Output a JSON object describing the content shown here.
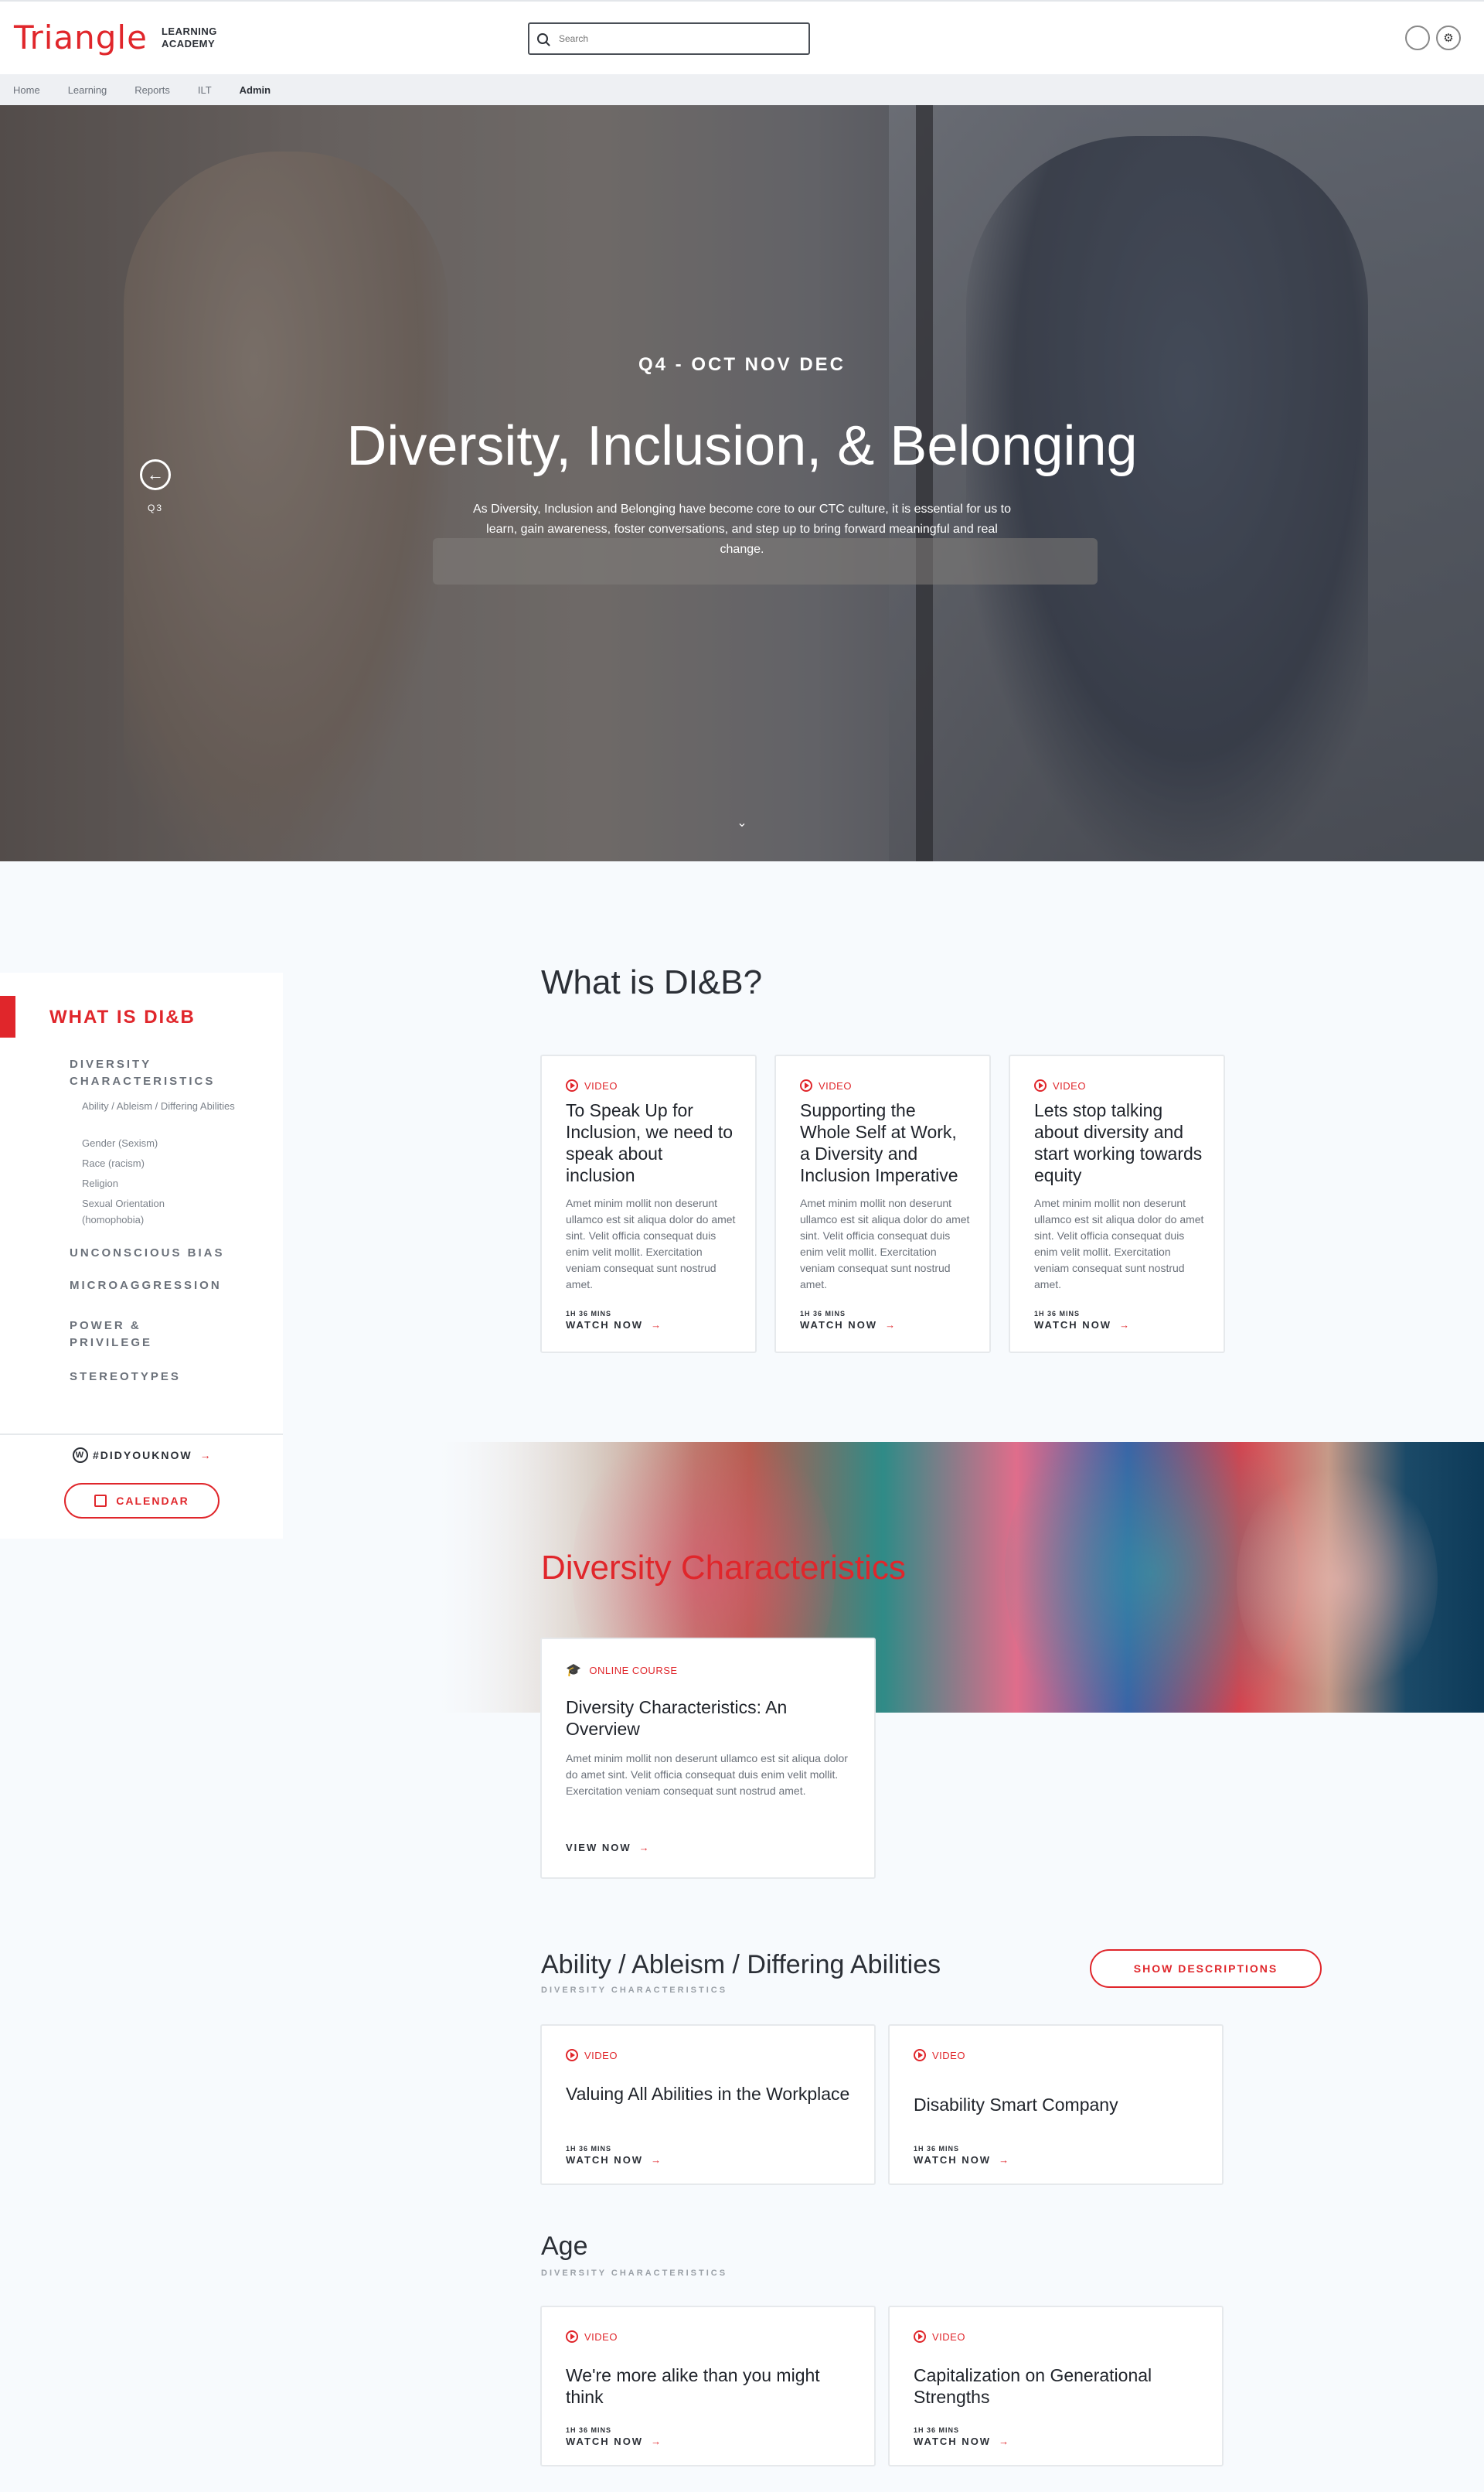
{
  "header": {
    "logo_text": "Triangle",
    "logo_sub_line1": "LEARNING",
    "logo_sub_line2": "ACADEMY",
    "search_placeholder": "Search"
  },
  "nav": {
    "items": [
      "Home",
      "Learning",
      "Reports",
      "ILT",
      "Admin"
    ],
    "active": "Admin"
  },
  "hero": {
    "eyebrow": "Q4 - OCT NOV DEC",
    "title": "Diversity, Inclusion, & Belonging",
    "description": "As Diversity, Inclusion and Belonging have become core to our CTC culture, it is essential for us to learn, gain awareness, foster conversations, and step up to bring forward meaningful and real change.",
    "prev_label": "Q3"
  },
  "sidebar": {
    "title": "WHAT IS DI&B",
    "links": [
      {
        "label": "DIVERSITY CHARACTERISTICS",
        "subs": [
          "Ability / Ableism / Differing Abilities",
          "Gender (Sexism)",
          "Race (racism)",
          "Religion",
          "Sexual Orientation (homophobia)"
        ]
      },
      {
        "label": "UNCONSCIOUS BIAS"
      },
      {
        "label": "MICROAGGRESSION"
      },
      {
        "label": "POWER & PRIVILEGE"
      },
      {
        "label": "STEREOTYPES"
      }
    ],
    "didyouknow": "#DIDYOUKNOW",
    "calendar": "CALENDAR"
  },
  "whatis": {
    "title": "What is DI&B?",
    "cards": [
      {
        "kind": "VIDEO",
        "title": "To Speak Up for Inclusion, we need to speak about inclusion",
        "desc": "Amet minim mollit non deserunt ullamco est sit aliqua dolor do amet sint. Velit officia consequat duis enim velit mollit. Exercitation veniam consequat sunt nostrud amet.",
        "duration": "1H 36 MINS",
        "action": "WATCH NOW"
      },
      {
        "kind": "VIDEO",
        "title": "Supporting the Whole Self at Work, a Diversity and Inclusion Imperative",
        "desc": "Amet minim mollit non deserunt ullamco est sit aliqua dolor do amet sint. Velit officia consequat duis enim velit mollit. Exercitation veniam consequat sunt nostrud amet.",
        "duration": "1H 36 MINS",
        "action": "WATCH NOW"
      },
      {
        "kind": "VIDEO",
        "title": "Lets stop talking about diversity and start working towards equity",
        "desc": "Amet minim mollit non deserunt ullamco est sit aliqua dolor do amet sint. Velit officia consequat duis enim velit mollit. Exercitation veniam consequat sunt nostrud amet.",
        "duration": "1H 36 MINS",
        "action": "WATCH NOW"
      }
    ]
  },
  "diversity": {
    "title": "Diversity Characteristics",
    "course": {
      "kind": "ONLINE COURSE",
      "title": "Diversity Characteristics: An Overview",
      "desc": "Amet minim mollit non deserunt ullamco est sit aliqua dolor do amet sint. Velit officia consequat duis enim velit mollit. Exercitation veniam consequat sunt nostrud amet.",
      "action": "VIEW NOW"
    }
  },
  "ability": {
    "title": "Ability / Ableism / Differing Abilities",
    "eyebrow": "DIVERSITY CHARACTERISTICS",
    "show_button": "SHOW DESCRIPTIONS",
    "cards": [
      {
        "kind": "VIDEO",
        "title": "Valuing All Abilities in the Workplace",
        "duration": "1H 36 MINS",
        "action": "WATCH NOW"
      },
      {
        "kind": "VIDEO",
        "title": "Disability Smart Company",
        "duration": "1H 36 MINS",
        "action": "WATCH NOW"
      }
    ]
  },
  "age": {
    "title": "Age",
    "eyebrow": "DIVERSITY CHARACTERISTICS",
    "cards": [
      {
        "kind": "VIDEO",
        "title": "We're more alike than you might think",
        "duration": "1H 36 MINS",
        "action": "WATCH NOW"
      },
      {
        "kind": "VIDEO",
        "title": "Capitalization on Generational Strengths",
        "duration": "1H 36 MINS",
        "action": "WATCH NOW"
      }
    ]
  },
  "colors": {
    "accent": "#e0262b",
    "text": "#2b2f36",
    "background": "#f7fafd"
  }
}
